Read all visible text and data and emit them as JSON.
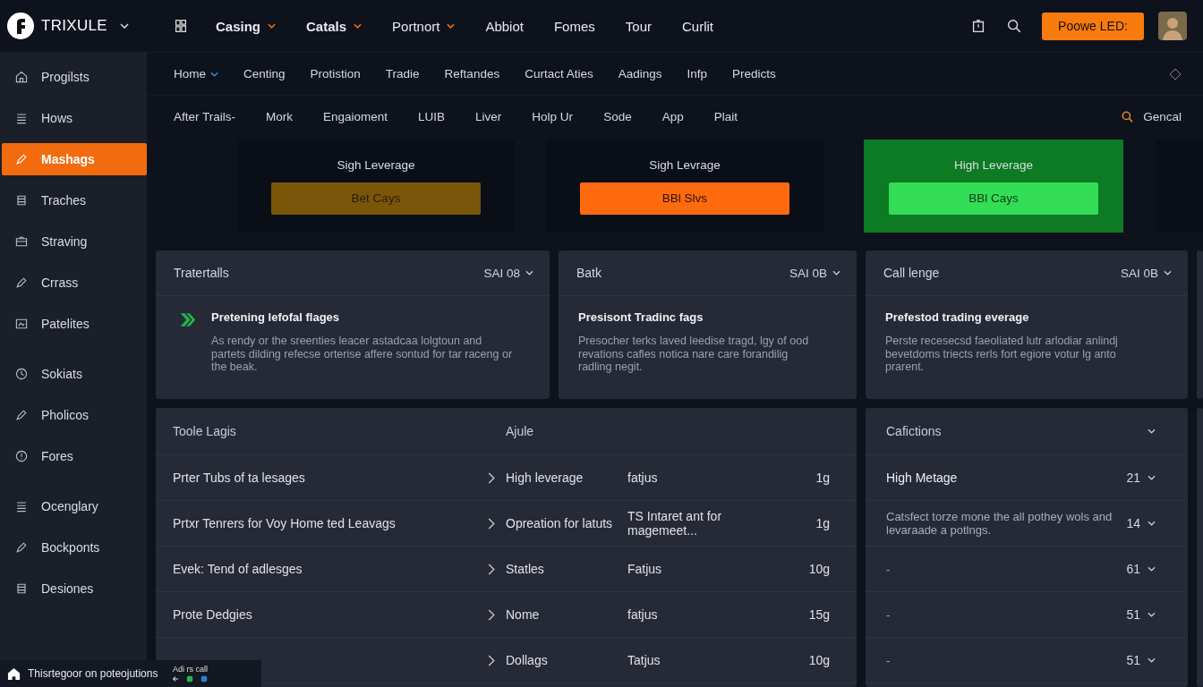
{
  "brand": {
    "name": "TRIXULE"
  },
  "top_nav": [
    {
      "label": "Casing",
      "bold": true,
      "dropdown": true
    },
    {
      "label": "Catals",
      "bold": true,
      "dropdown": true
    },
    {
      "label": "Portnort",
      "bold": false,
      "dropdown": true
    },
    {
      "label": "Abbiot",
      "bold": false,
      "dropdown": false
    },
    {
      "label": "Fomes",
      "bold": false,
      "dropdown": false
    },
    {
      "label": "Tour",
      "bold": false,
      "dropdown": false
    },
    {
      "label": "Curlit",
      "bold": false,
      "dropdown": false
    }
  ],
  "cta_button": "Poowe LED:",
  "sub_nav": [
    {
      "label": "Home",
      "dropdown": true
    },
    {
      "label": "Centing",
      "dropdown": false
    },
    {
      "label": "Protistion",
      "dropdown": false
    },
    {
      "label": "Tradie",
      "dropdown": false
    },
    {
      "label": "Reftandes",
      "dropdown": false
    },
    {
      "label": "Curtact Aties",
      "dropdown": false
    },
    {
      "label": "Aadings",
      "dropdown": false
    },
    {
      "label": "Infp",
      "dropdown": false
    },
    {
      "label": "Predicts",
      "dropdown": false
    }
  ],
  "filter_nav": [
    "After Trails-",
    "Mork",
    "Engaioment",
    "LUIB",
    "Liver",
    "Holp Ur",
    "Sode",
    "App",
    "Plait"
  ],
  "search_label": "Gencal",
  "sidebar": {
    "groups": [
      {
        "items": [
          {
            "label": "Progilsts",
            "selected": false
          },
          {
            "label": "Hows",
            "selected": false
          },
          {
            "label": "Mashags",
            "selected": true
          },
          {
            "label": "Traches",
            "selected": false
          },
          {
            "label": "Straving",
            "selected": false
          },
          {
            "label": "Crrass",
            "selected": false
          },
          {
            "label": "Patelites",
            "selected": false
          }
        ]
      },
      {
        "items": [
          {
            "label": "Sokiats",
            "selected": false
          },
          {
            "label": "Pholicos",
            "selected": false
          },
          {
            "label": "Fores",
            "selected": false
          }
        ]
      },
      {
        "items": [
          {
            "label": "Ocenglary",
            "selected": false
          },
          {
            "label": "Bockponts",
            "selected": false
          },
          {
            "label": "Desiones",
            "selected": false
          }
        ]
      }
    ]
  },
  "promos": [
    {
      "title": "Sigh Leverage",
      "button": "Bet Cays",
      "kind": "muted"
    },
    {
      "title": "Sigh Levrage",
      "button": "BBl Slvs",
      "kind": "orange"
    },
    {
      "title": "High Leverage",
      "button": "BBl Cays",
      "kind": "green"
    }
  ],
  "panels": [
    {
      "title": "Tratertalls",
      "badge": "SAI 08",
      "heading": "Pretening lefofal flages",
      "body": "As rendy or the sreenties leacer astadcaa lolgtoun and partets dilding refecse orterise affere sontud for tar raceng or the beak.",
      "icon": true
    },
    {
      "title": "Batk",
      "badge": "SAI 0B",
      "heading": "Presisont Tradinc fags",
      "body": "Presocher terks laved leedise tragd, lgy of ood revations cafles notica nare care forandilig radling negit.",
      "icon": false
    },
    {
      "title": "Call lenge",
      "badge": "SAI 0B",
      "heading": "Prefestod trading everage",
      "body": "Perste recesecsd faeoliated lutr arlodiar anlindj bevetdoms triects rerls fort egiore votur lg anto prarent.",
      "icon": false
    }
  ],
  "table": {
    "columns": [
      "Toole Lagis",
      "Ajule"
    ],
    "rows": [
      {
        "name": "Prter Tubs of ta lesages",
        "type": "High leverage",
        "status": "fatjus",
        "amount": "1g"
      },
      {
        "name": "Prtxr Tenrers for Voy Home ted Leavags",
        "type": "Opreation for latuts",
        "status": "TS Intaret ant for magemeet...",
        "amount": "1g"
      },
      {
        "name": "Evek: Tend of adlesges",
        "type": "Statles",
        "status": "Fatjus",
        "amount": "10g"
      },
      {
        "name": "Prote Dedgies",
        "type": "Nome",
        "status": "fatjus",
        "amount": "15g"
      },
      {
        "type": "Dollags",
        "status": "Tatjus",
        "amount": "10g"
      }
    ]
  },
  "side_list": {
    "title": "Cafictions",
    "rows": [
      {
        "label": "High Metage",
        "count": "21",
        "strong": true
      },
      {
        "label": "Catsfect torze mone the all pothey wols and levaraade a potlngs.",
        "count": "14",
        "strong": false
      },
      {
        "label": "-",
        "count": "61",
        "strong": false
      },
      {
        "label": "-",
        "count": "51",
        "strong": false
      },
      {
        "label": "-",
        "count": "51",
        "strong": false
      }
    ]
  },
  "toast": {
    "message": "Thisrtegoor on poteojutions",
    "action": "Adi rs call"
  }
}
